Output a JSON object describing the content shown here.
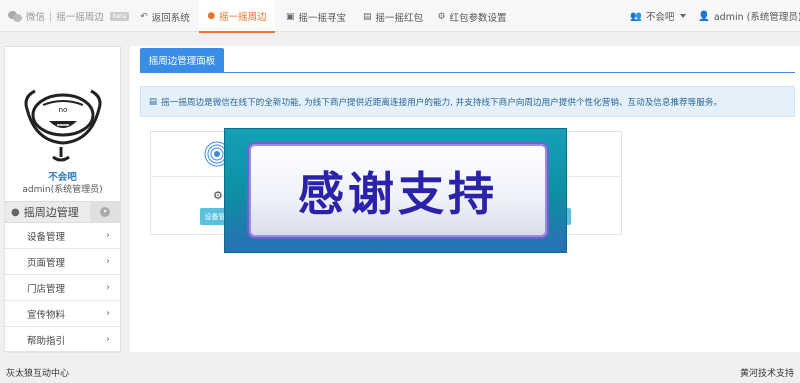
{
  "brand": {
    "app": "微信",
    "separator": "|",
    "module": "摇一摇周边",
    "badge": "beta"
  },
  "nav": {
    "back": "返回系统",
    "shake_nearby": "摇一摇周边",
    "treasure": "摇一摇寻宝",
    "red_packet": "摇一摇红包",
    "red_packet_settings": "红包参数设置"
  },
  "user_menu": {
    "account": "不会吧",
    "admin": "admin (系统管理员)"
  },
  "sidebar": {
    "name": "不会吧",
    "role": "admin(系统管理员)",
    "menu_title": "摇周边管理",
    "items": [
      {
        "label": "设备管理"
      },
      {
        "label": "页面管理"
      },
      {
        "label": "门店管理"
      },
      {
        "label": "宣传物料"
      },
      {
        "label": "帮助指引"
      }
    ]
  },
  "panel": {
    "tab": "摇周边管理面板",
    "info": "摇一摇周边是微信在线下的全新功能, 为线下商户提供近距离连接用户的能力, 并支持线下商户向周边用户提供个性化营销、互动及信息推荐等服务。",
    "device_btn": "设备管"
  },
  "banner": {
    "text": "感谢支持"
  },
  "footer": {
    "left": "灰太狼互动中心",
    "right": "黄河技术支持"
  },
  "colors": {
    "accent": "#e8752a",
    "primary": "#3a8de6",
    "info_bg": "#e4f1fb",
    "button": "#5bc0de"
  }
}
